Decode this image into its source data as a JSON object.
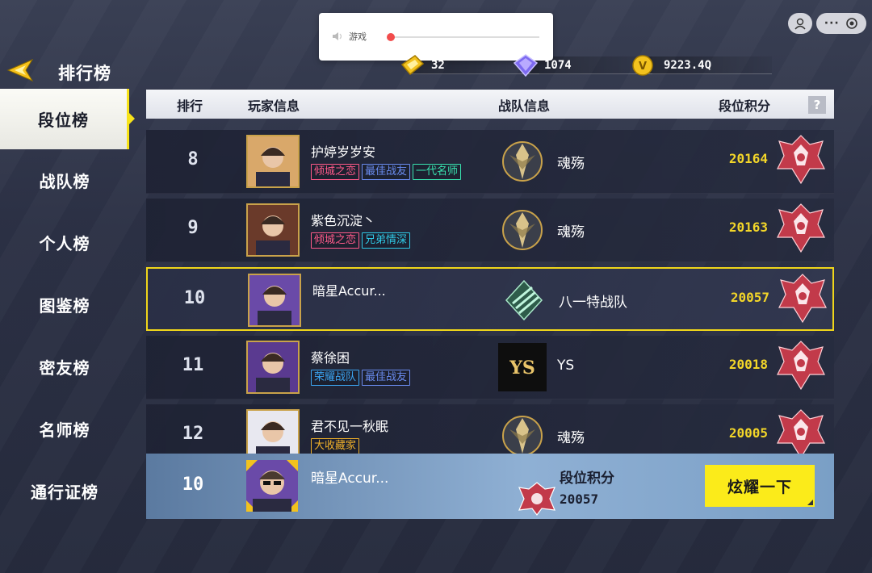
{
  "header": {
    "title": "排行榜",
    "currencies": [
      {
        "icon": "gold-ticket-icon",
        "value": "32"
      },
      {
        "icon": "diamond-icon",
        "value": "1074"
      },
      {
        "icon": "v-coin-icon",
        "value": "9223.4Q"
      }
    ]
  },
  "popup": {
    "label": "游戏",
    "volume": 0.02
  },
  "sidebar": {
    "items": [
      {
        "label": "段位榜",
        "active": true
      },
      {
        "label": "战队榜"
      },
      {
        "label": "个人榜"
      },
      {
        "label": "图鉴榜"
      },
      {
        "label": "密友榜"
      },
      {
        "label": "名师榜"
      },
      {
        "label": "通行证榜"
      }
    ]
  },
  "table": {
    "columns": [
      "排行",
      "玩家信息",
      "战队信息",
      "段位积分"
    ],
    "help": "?",
    "rows": [
      {
        "rank": "8",
        "name": "护婷岁岁安",
        "tags": [
          {
            "text": "倾城之恋",
            "color": "#ff5a8a"
          },
          {
            "text": "最佳战友",
            "color": "#6a8cf0"
          },
          {
            "text": "一代名师",
            "color": "#39e3b0"
          }
        ],
        "team": "魂殇",
        "score": "20164"
      },
      {
        "rank": "9",
        "name": "紫色沉淀丶",
        "tags": [
          {
            "text": "倾城之恋",
            "color": "#ff5a8a"
          },
          {
            "text": "兄弟情深",
            "color": "#2fc9e6"
          }
        ],
        "team": "魂殇",
        "score": "20163"
      },
      {
        "rank": "10",
        "name": "暗星Accur...",
        "tags": [],
        "team": "八一特战队",
        "score": "20057",
        "highlight": true
      },
      {
        "rank": "11",
        "name": "蔡徐困",
        "tags": [
          {
            "text": "荣耀战队",
            "color": "#3ba4f0"
          },
          {
            "text": "最佳战友",
            "color": "#6a8cf0"
          }
        ],
        "team": "YS",
        "score": "20018"
      },
      {
        "rank": "12",
        "name": "君不见一秋眠",
        "tags": [
          {
            "text": "大收藏家",
            "color": "#f0b02a"
          }
        ],
        "team": "魂殇",
        "score": "20005"
      }
    ]
  },
  "self": {
    "rank": "10",
    "name": "暗星Accur...",
    "score_label": "段位积分",
    "score": "20057",
    "button": "炫耀一下"
  }
}
